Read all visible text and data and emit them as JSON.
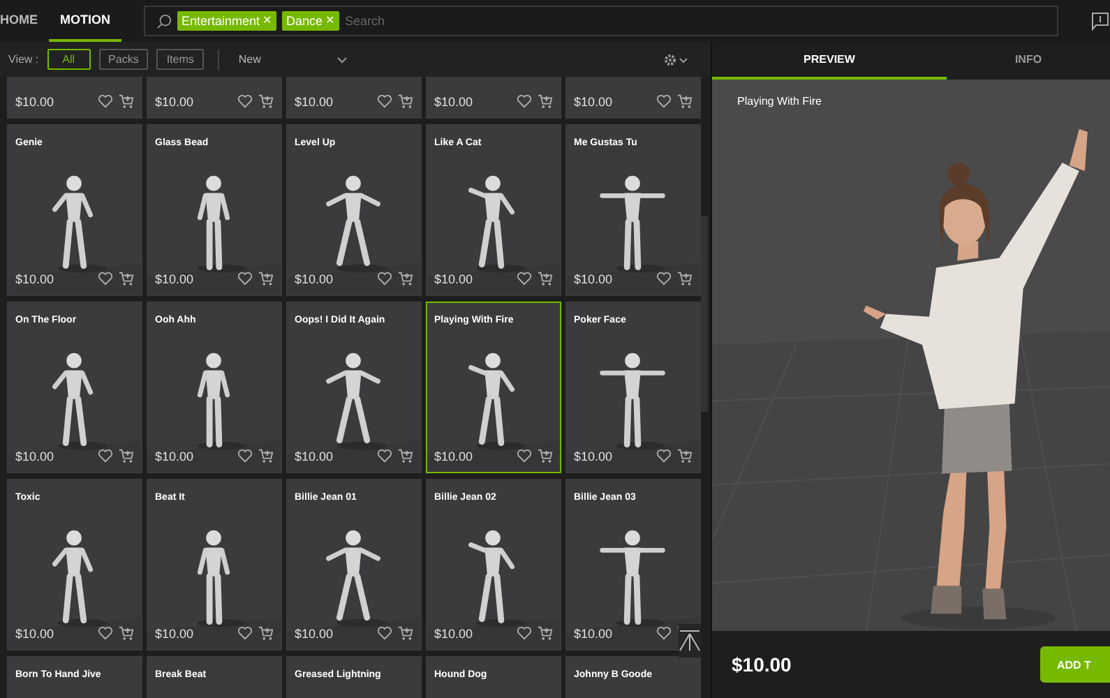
{
  "top_tabs": [
    {
      "label": "HOME",
      "selected": false
    },
    {
      "label": "MOTION",
      "selected": true
    }
  ],
  "search": {
    "tags": [
      {
        "label": "Entertainment",
        "remove": "✕"
      },
      {
        "label": "Dance",
        "remove": "✕"
      }
    ],
    "placeholder": "Search"
  },
  "view": {
    "label": "View :",
    "filters": [
      {
        "label": "All",
        "selected": true
      },
      {
        "label": "Packs",
        "selected": false
      },
      {
        "label": "Items",
        "selected": false
      }
    ],
    "sort": "New"
  },
  "items": [
    {
      "price": "$10.00",
      "selected": false
    },
    {
      "price": "$10.00",
      "selected": false
    },
    {
      "price": "$10.00",
      "selected": false
    },
    {
      "price": "$10.00",
      "selected": false
    },
    {
      "price": "$10.00",
      "selected": false
    },
    {
      "title": "Genie",
      "price": "$10.00",
      "selected": false
    },
    {
      "title": "Glass Bead",
      "price": "$10.00",
      "selected": false
    },
    {
      "title": "Level Up",
      "price": "$10.00",
      "selected": false
    },
    {
      "title": "Like A Cat",
      "price": "$10.00",
      "selected": false
    },
    {
      "title": "Me Gustas Tu",
      "price": "$10.00",
      "selected": false
    },
    {
      "title": "On The Floor",
      "price": "$10.00",
      "selected": false
    },
    {
      "title": "Ooh Ahh",
      "price": "$10.00",
      "selected": false
    },
    {
      "title": "Oops! I Did It Again",
      "price": "$10.00",
      "selected": false
    },
    {
      "title": "Playing With Fire",
      "price": "$10.00",
      "selected": true
    },
    {
      "title": "Poker Face",
      "price": "$10.00",
      "selected": false
    },
    {
      "title": "Toxic",
      "price": "$10.00",
      "selected": false
    },
    {
      "title": "Beat It",
      "price": "$10.00",
      "selected": false
    },
    {
      "title": "Billie Jean 01",
      "price": "$10.00",
      "selected": false
    },
    {
      "title": "Billie Jean 02",
      "price": "$10.00",
      "selected": false
    },
    {
      "title": "Billie Jean 03",
      "price": "$10.00",
      "selected": false
    },
    {
      "title": "Born To Hand Jive",
      "selected": false
    },
    {
      "title": "Break Beat",
      "selected": false
    },
    {
      "title": "Greased Lightning",
      "selected": false
    },
    {
      "title": "Hound Dog",
      "selected": false
    },
    {
      "title": "Johnny B Goode",
      "selected": false
    }
  ],
  "panel_tabs": [
    {
      "label": "PREVIEW",
      "selected": true
    },
    {
      "label": "INFO",
      "selected": false
    }
  ],
  "preview": {
    "title": "Playing With Fire",
    "price": "$10.00",
    "button": "ADD T"
  }
}
